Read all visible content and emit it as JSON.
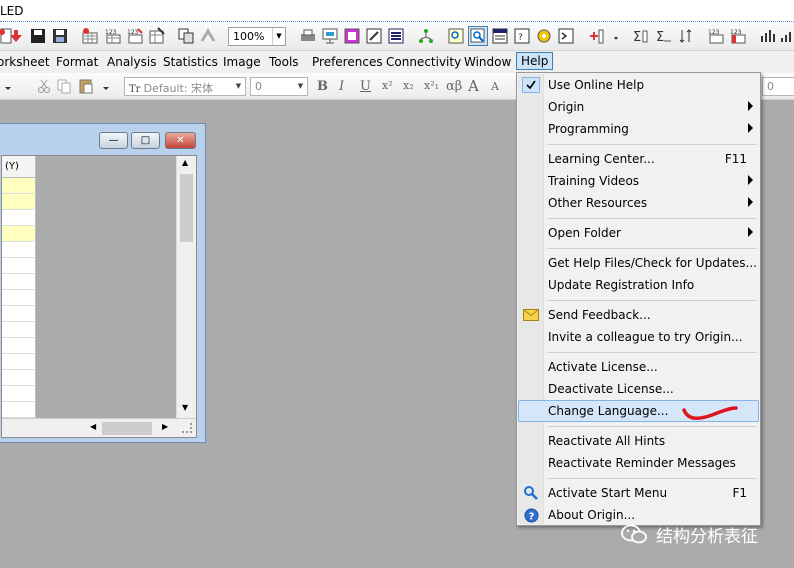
{
  "titlebar": {
    "text": "LED"
  },
  "toolbar": {
    "zoom_value": "100%"
  },
  "menubar": {
    "items": [
      "orksheet",
      "Format",
      "Analysis",
      "Statistics",
      "Image",
      "Tools",
      "Preferences",
      "Connectivity",
      "Window",
      "Help"
    ]
  },
  "format_toolbar": {
    "font_placeholder": "Default: 宋体",
    "font_size": "0",
    "right_value": "0",
    "bold": "B",
    "italic": "I",
    "underline": "U",
    "superscript": "x²",
    "subscript": "x₂",
    "super_sub": "x²₁",
    "greek": "αβ",
    "grow_font": "A",
    "shrink_font": "A"
  },
  "worksheet": {
    "column_header": "(Y)",
    "min_glyph": "—",
    "max_glyph": "□",
    "close_glyph": "✕"
  },
  "help_menu": {
    "items": [
      {
        "label": "Use Online Help",
        "shortcut": "",
        "submenu": false,
        "icon": "checkmark-icon"
      },
      {
        "label": "Origin",
        "shortcut": "",
        "submenu": true,
        "icon": ""
      },
      {
        "label": "Programming",
        "shortcut": "",
        "submenu": true,
        "icon": ""
      },
      {
        "label": "Learning Center...",
        "shortcut": "F11",
        "submenu": false,
        "icon": ""
      },
      {
        "label": "Training Videos",
        "shortcut": "",
        "submenu": true,
        "icon": ""
      },
      {
        "label": "Other Resources",
        "shortcut": "",
        "submenu": true,
        "icon": ""
      },
      {
        "label": "Open Folder",
        "shortcut": "",
        "submenu": true,
        "icon": ""
      },
      {
        "label": "Get Help Files/Check for Updates...",
        "shortcut": "",
        "submenu": false,
        "icon": ""
      },
      {
        "label": "Update Registration Info",
        "shortcut": "",
        "submenu": false,
        "icon": ""
      },
      {
        "label": "Send Feedback...",
        "shortcut": "",
        "submenu": false,
        "icon": "envelope-icon"
      },
      {
        "label": "Invite a colleague to try Origin...",
        "shortcut": "",
        "submenu": false,
        "icon": ""
      },
      {
        "label": "Activate License...",
        "shortcut": "",
        "submenu": false,
        "icon": ""
      },
      {
        "label": "Deactivate License...",
        "shortcut": "",
        "submenu": false,
        "icon": ""
      },
      {
        "label": "Change Language...",
        "shortcut": "",
        "submenu": false,
        "icon": "",
        "highlighted": true
      },
      {
        "label": "Reactivate All Hints",
        "shortcut": "",
        "submenu": false,
        "icon": ""
      },
      {
        "label": "Reactivate Reminder Messages",
        "shortcut": "",
        "submenu": false,
        "icon": ""
      },
      {
        "label": "Activate Start Menu",
        "shortcut": "F1",
        "submenu": false,
        "icon": "search-icon"
      },
      {
        "label": "About Origin...",
        "shortcut": "",
        "submenu": false,
        "icon": "question-icon"
      }
    ]
  },
  "watermark": {
    "text": "结构分析表征"
  },
  "colors": {
    "menu_highlight": "#d5e6f8",
    "menu_highlight_border": "#84b4e5",
    "annotation_red": "#e0141e",
    "desktop_gray": "#ababab"
  }
}
